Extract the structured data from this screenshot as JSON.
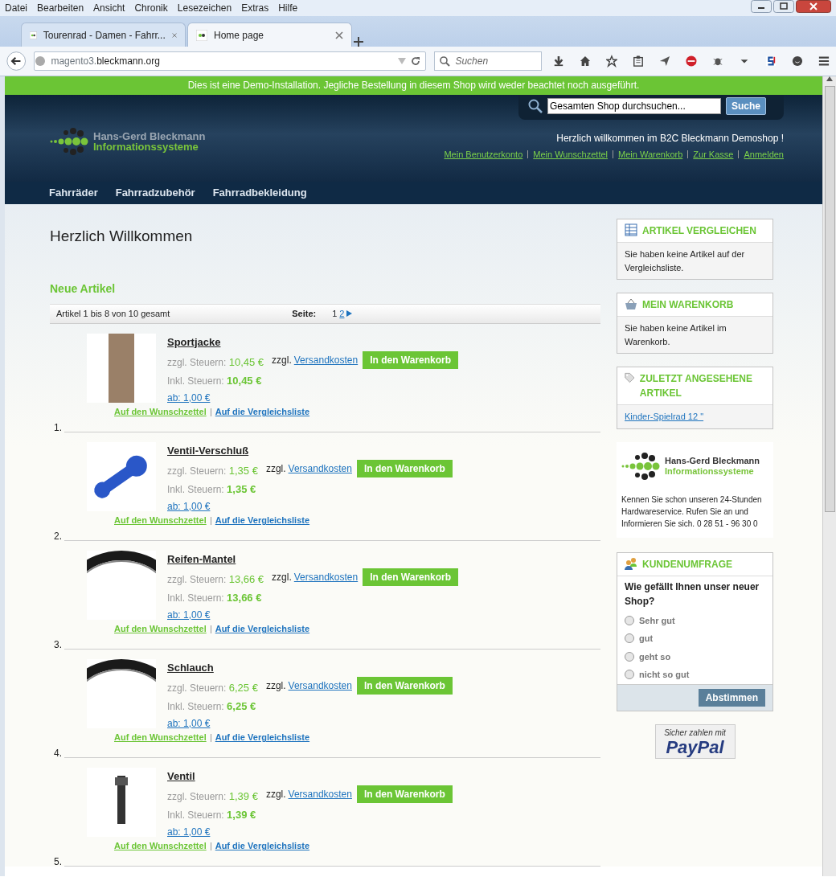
{
  "browser": {
    "menu": [
      "Datei",
      "Bearbeiten",
      "Ansicht",
      "Chronik",
      "Lesezeichen",
      "Extras",
      "Hilfe"
    ],
    "tabs": [
      {
        "title": "Tourenrad - Damen - Fahrr...",
        "selected": false
      },
      {
        "title": "Home page",
        "selected": true
      }
    ],
    "url_host": "magento3.",
    "url_domain": "bleckmann.org",
    "search_placeholder": "Suchen"
  },
  "demo_banner": "Dies ist eine Demo-Installation. Jegliche Bestellung in diesem Shop wird weder beachtet noch ausgeführt.",
  "header": {
    "logo_line_1": "Hans-Gerd Bleckmann",
    "logo_line_2": "Informationssysteme",
    "search_value": "Gesamten Shop durchsuchen...",
    "search_button": "Suche",
    "welcome": "Herzlich willkommen im B2C Bleckmann Demoshop !",
    "links": [
      "Mein Benutzerkonto",
      "Mein Wunschzettel",
      "Mein Warenkorb",
      "Zur Kasse",
      "Anmelden"
    ],
    "nav": [
      "Fahrräder",
      "Fahrradzubehör",
      "Fahrradbekleidung"
    ]
  },
  "main": {
    "title": "Herzlich Willkommen",
    "section_title": "Neue Artikel",
    "toolbar": {
      "count": "Artikel 1 bis 8 von 10 gesamt",
      "page_label": "Seite:",
      "pages": [
        {
          "label": "1",
          "selected": true
        },
        {
          "label": "2",
          "selected": false
        }
      ]
    },
    "products": [
      {
        "number": "1.",
        "name": "Sportjacke",
        "tax_excl_label": "zzgl. Steuern:",
        "tax_excl_price": "10,45 €",
        "tax_incl_label": "Inkl. Steuern:",
        "tax_incl_price": "10,45 €",
        "from_price": "ab: 1,00 €",
        "shipping_prefix": "zzgl.",
        "shipping_link": "Versandkosten",
        "cart_button": "In den Warenkorb",
        "wishlist_link": "Auf den Wunschzettel",
        "compare_link": "Auf die Vergleichsliste"
      },
      {
        "number": "2.",
        "name": "Ventil-Verschluß",
        "tax_excl_label": "zzgl. Steuern:",
        "tax_excl_price": "1,35 €",
        "tax_incl_label": "Inkl. Steuern:",
        "tax_incl_price": "1,35 €",
        "from_price": "ab: 1,00 €",
        "shipping_prefix": "zzgl.",
        "shipping_link": "Versandkosten",
        "cart_button": "In den Warenkorb",
        "wishlist_link": "Auf den Wunschzettel",
        "compare_link": "Auf die Vergleichsliste"
      },
      {
        "number": "3.",
        "name": "Reifen-Mantel",
        "tax_excl_label": "zzgl. Steuern:",
        "tax_excl_price": "13,66 €",
        "tax_incl_label": "Inkl. Steuern:",
        "tax_incl_price": "13,66 €",
        "from_price": "ab: 1,00 €",
        "shipping_prefix": "zzgl.",
        "shipping_link": "Versandkosten",
        "cart_button": "In den Warenkorb",
        "wishlist_link": "Auf den Wunschzettel",
        "compare_link": "Auf die Vergleichsliste"
      },
      {
        "number": "4.",
        "name": "Schlauch",
        "tax_excl_label": "zzgl. Steuern:",
        "tax_excl_price": "6,25 €",
        "tax_incl_label": "Inkl. Steuern:",
        "tax_incl_price": "6,25 €",
        "from_price": "ab: 1,00 €",
        "shipping_prefix": "zzgl.",
        "shipping_link": "Versandkosten",
        "cart_button": "In den Warenkorb",
        "wishlist_link": "Auf den Wunschzettel",
        "compare_link": "Auf die Vergleichsliste"
      },
      {
        "number": "5.",
        "name": "Ventil",
        "tax_excl_label": "zzgl. Steuern:",
        "tax_excl_price": "1,39 €",
        "tax_incl_label": "Inkl. Steuern:",
        "tax_incl_price": "1,39 €",
        "from_price": "ab: 1,00 €",
        "shipping_prefix": "zzgl.",
        "shipping_link": "Versandkosten",
        "cart_button": "In den Warenkorb",
        "wishlist_link": "Auf den Wunschzettel",
        "compare_link": "Auf die Vergleichsliste"
      }
    ]
  },
  "sidebar": {
    "blocks": [
      {
        "kind": "text",
        "title": "ARTIKEL VERGLEICHEN",
        "text": "Sie haben keine Artikel auf der Vergleichsliste."
      },
      {
        "kind": "text",
        "title": "MEIN WARENKORB",
        "text": "Sie haben keine Artikel im Warenkorb."
      },
      {
        "kind": "link",
        "title": "ZULETZT ANGESEHENE ARTIKEL",
        "link": "Kinder-Spielrad 12 \""
      }
    ],
    "promo": {
      "logo_line_1": "Hans-Gerd Bleckmann",
      "logo_line_2": "Informationssysteme",
      "text": "Kennen Sie schon unseren 24-Stunden Hardwareservice. Rufen Sie an und Informieren Sie sich. 0 28 51 - 96 30 0"
    },
    "poll": {
      "title": "KUNDENUMFRAGE",
      "question": "Wie gefällt Ihnen unser neuer Shop?",
      "options": [
        {
          "label": "Sehr gut",
          "selected": false
        },
        {
          "label": "gut",
          "selected": false
        },
        {
          "label": "geht so",
          "selected": false
        },
        {
          "label": "nicht so gut",
          "selected": false
        }
      ],
      "button": "Abstimmen"
    },
    "paypal": {
      "line_1": "Sicher zahlen mit",
      "line_2": "PayPal"
    }
  }
}
